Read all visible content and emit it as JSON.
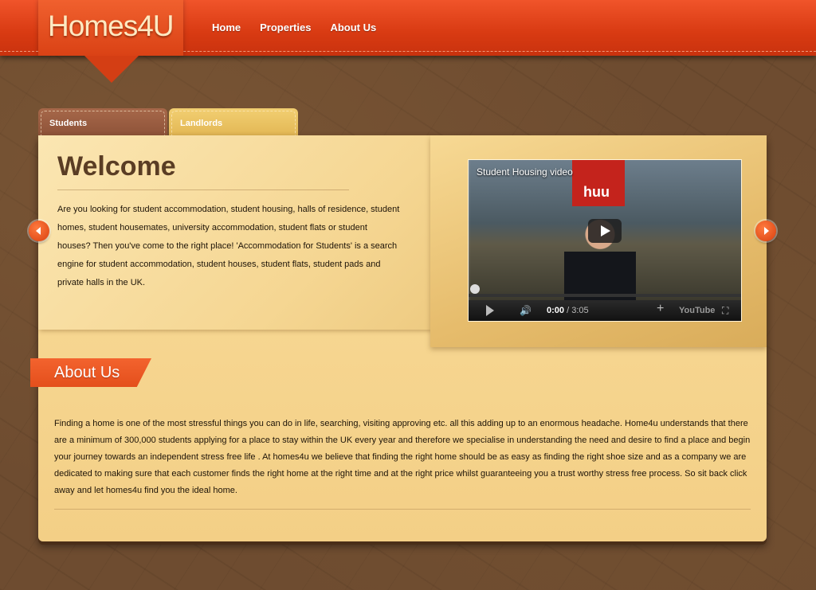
{
  "site": {
    "logo": "Homes4U"
  },
  "nav": {
    "items": [
      "Home",
      "Properties",
      "About Us"
    ]
  },
  "tabs": [
    "Students",
    "Landlords"
  ],
  "welcome": {
    "title": "Welcome",
    "body": "Are you looking for student accommodation, student housing, halls of residence, student homes, student housemates, university accommodation, student flats or student houses? Then you've come to the right place! 'Accommodation for Students' is a search engine for student accommodation, student houses, student flats, student pads and private halls in the UK."
  },
  "video": {
    "title": "Student Housing video",
    "sign_text": "huu",
    "current_time": "0:00",
    "duration": "/ 3:05",
    "brand": "YouTube"
  },
  "about": {
    "heading": "About Us",
    "body": "Finding a home is one of the most stressful things you can do in life, searching, visiting approving etc. all this adding up to an enormous headache. Home4u understands that there are a minimum of 300,000 students applying for a place to stay within the UK every year and therefore we specialise in understanding the need and desire to find a place and begin your journey towards an independent stress free life . At homes4u we believe that finding the right home should be as easy as finding the right shoe size and as a company we are dedicated to making sure that each customer finds the right home at the right time and at the right price whilst guaranteeing you a trust worthy stress free process. So sit back click away and let homes4u find you the ideal home."
  },
  "colors": {
    "header": "#d83a12",
    "accent": "#e44f1c",
    "panel": "#f6d58e",
    "background": "#6e4c30"
  }
}
